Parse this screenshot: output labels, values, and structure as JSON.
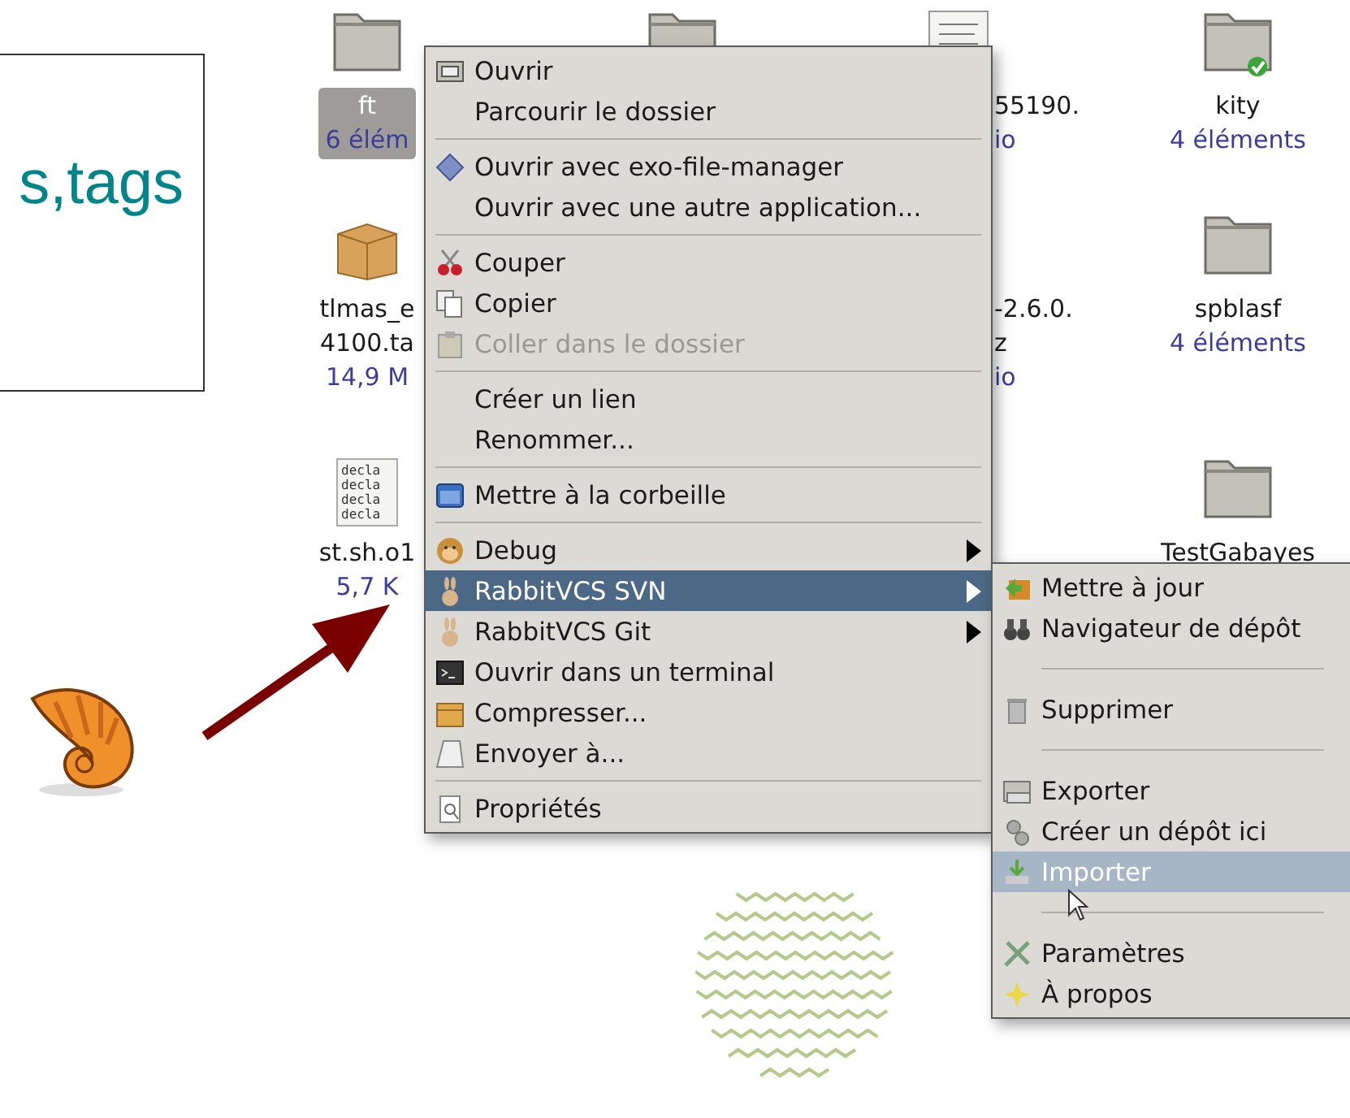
{
  "slide": {
    "text": "s,tags"
  },
  "icon_view": {
    "columns": [
      {
        "items": [
          {
            "kind": "folder",
            "selected": true,
            "synced": false,
            "name_lines": [
              "ft"
            ],
            "detail": "6 élém"
          },
          {
            "kind": "package",
            "selected": false,
            "name_lines": [
              "tlmas_e",
              "4100.ta"
            ],
            "detail": "14,9 M"
          },
          {
            "kind": "script",
            "selected": false,
            "name_lines": [
              "st.sh.o1"
            ],
            "detail": "5,7 K",
            "thumbnail_lines": [
              "decla",
              "decla",
              "decla",
              "decla"
            ]
          }
        ]
      },
      {
        "items": [
          {
            "kind": "folder",
            "selected": false,
            "synced": false
          }
        ]
      },
      {
        "items": [
          {
            "kind": "text-file",
            "selected": false,
            "name_lines": [
              "55190."
            ],
            "detail": "io"
          },
          {
            "kind": "hidden",
            "selected": false,
            "name_lines": [
              "-2.6.0.",
              "z"
            ],
            "detail": "io"
          }
        ]
      },
      {
        "items": [
          {
            "kind": "folder",
            "selected": false,
            "synced": true,
            "name_lines": [
              "kity"
            ],
            "detail": "4 éléments"
          },
          {
            "kind": "folder",
            "selected": false,
            "synced": false,
            "name_lines": [
              "spblasf"
            ],
            "detail": "4 éléments"
          },
          {
            "kind": "folder",
            "selected": false,
            "synced": false,
            "name_lines": [
              "TestGabayes"
            ]
          }
        ]
      }
    ]
  },
  "context_menu": {
    "items": [
      {
        "kind": "item",
        "label": "Ouvrir",
        "disabled": false,
        "selected": false,
        "submenu": false
      },
      {
        "kind": "item",
        "label": "Parcourir le dossier",
        "disabled": false,
        "selected": false,
        "submenu": false
      },
      {
        "kind": "separator"
      },
      {
        "kind": "item",
        "label": "Ouvrir avec exo-file-manager",
        "disabled": false,
        "selected": false,
        "submenu": false
      },
      {
        "kind": "item",
        "label": "Ouvrir avec une autre application...",
        "disabled": false,
        "selected": false,
        "submenu": false
      },
      {
        "kind": "separator"
      },
      {
        "kind": "item",
        "label": "Couper",
        "disabled": false,
        "selected": false,
        "submenu": false
      },
      {
        "kind": "item",
        "label": "Copier",
        "disabled": false,
        "selected": false,
        "submenu": false
      },
      {
        "kind": "item",
        "label": "Coller dans le dossier",
        "disabled": true,
        "selected": false,
        "submenu": false
      },
      {
        "kind": "separator"
      },
      {
        "kind": "item",
        "label": "Créer un lien",
        "disabled": false,
        "selected": false,
        "submenu": false
      },
      {
        "kind": "item",
        "label": "Renommer...",
        "disabled": false,
        "selected": false,
        "submenu": false
      },
      {
        "kind": "separator"
      },
      {
        "kind": "item",
        "label": "Mettre à la corbeille",
        "disabled": false,
        "selected": false,
        "submenu": false
      },
      {
        "kind": "separator"
      },
      {
        "kind": "item",
        "label": "Debug",
        "disabled": false,
        "selected": false,
        "submenu": true
      },
      {
        "kind": "item",
        "label": "RabbitVCS SVN",
        "disabled": false,
        "selected": true,
        "submenu": true
      },
      {
        "kind": "item",
        "label": "RabbitVCS Git",
        "disabled": false,
        "selected": false,
        "submenu": true
      },
      {
        "kind": "item",
        "label": "Ouvrir dans un terminal",
        "disabled": false,
        "selected": false,
        "submenu": false
      },
      {
        "kind": "item",
        "label": "Compresser...",
        "disabled": false,
        "selected": false,
        "submenu": false
      },
      {
        "kind": "item",
        "label": "Envoyer à...",
        "disabled": false,
        "selected": false,
        "submenu": false
      },
      {
        "kind": "separator"
      },
      {
        "kind": "item",
        "label": "Propriétés",
        "disabled": false,
        "selected": false,
        "submenu": false
      }
    ]
  },
  "submenu": {
    "items": [
      {
        "kind": "item",
        "label": "Mettre à jour",
        "disabled": false,
        "selected": false
      },
      {
        "kind": "item",
        "label": "Navigateur de dépôt",
        "disabled": false,
        "selected": false
      },
      {
        "kind": "separator"
      },
      {
        "kind": "item",
        "label": "Supprimer",
        "disabled": false,
        "selected": false
      },
      {
        "kind": "separator"
      },
      {
        "kind": "item",
        "label": "Exporter",
        "disabled": false,
        "selected": false
      },
      {
        "kind": "item",
        "label": "Créer un dépôt ici",
        "disabled": false,
        "selected": false
      },
      {
        "kind": "item",
        "label": "Importer",
        "disabled": false,
        "selected": true
      },
      {
        "kind": "separator"
      },
      {
        "kind": "item",
        "label": "Paramètres",
        "disabled": false,
        "selected": false
      },
      {
        "kind": "item",
        "label": "À propos",
        "disabled": false,
        "selected": false
      }
    ]
  }
}
